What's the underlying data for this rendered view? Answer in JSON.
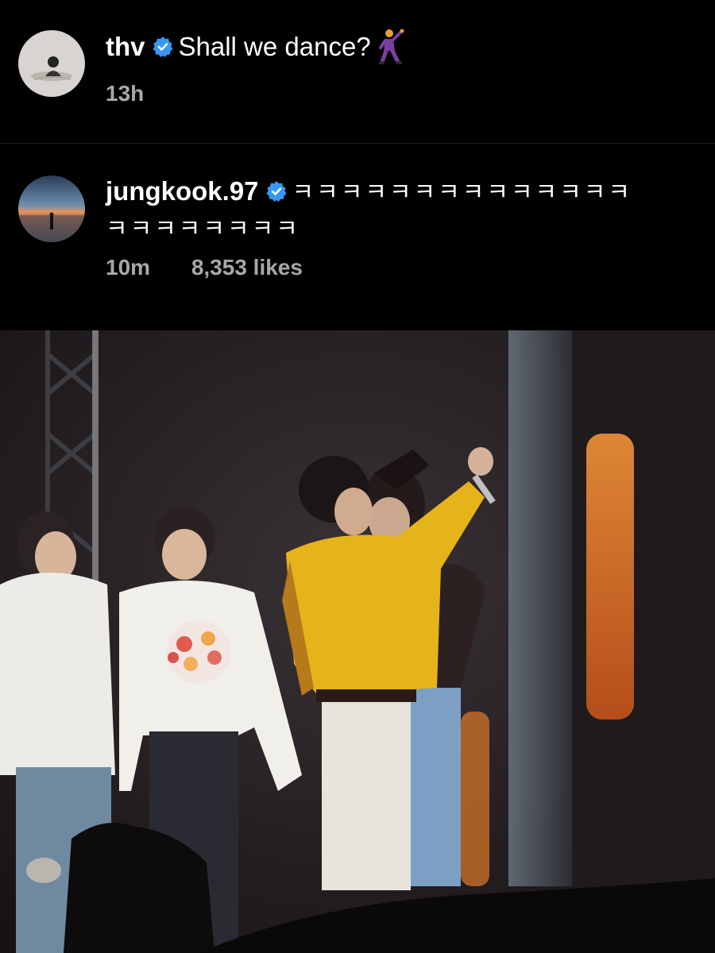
{
  "comments": [
    {
      "username": "thv",
      "verified": true,
      "text": "Shall we dance?",
      "emoji": "dancing-man-emoji",
      "time": "13h",
      "likes": ""
    },
    {
      "username": "jungkook.97",
      "verified": true,
      "text_line1": "ㅋㅋㅋㅋㅋㅋㅋㅋㅋㅋㅋㅋㅋㅋ",
      "text_line2": "ㅋㅋㅋㅋㅋㅋㅋㅋ",
      "time": "10m",
      "likes": "8,353 likes"
    }
  ],
  "colors": {
    "background": "#000000",
    "meta_text": "#a8a8a8",
    "verified_badge": "#3897f0",
    "jacket_yellow": "#e5b31a"
  },
  "photo": {
    "description_icon": "concert-stage-photo"
  }
}
